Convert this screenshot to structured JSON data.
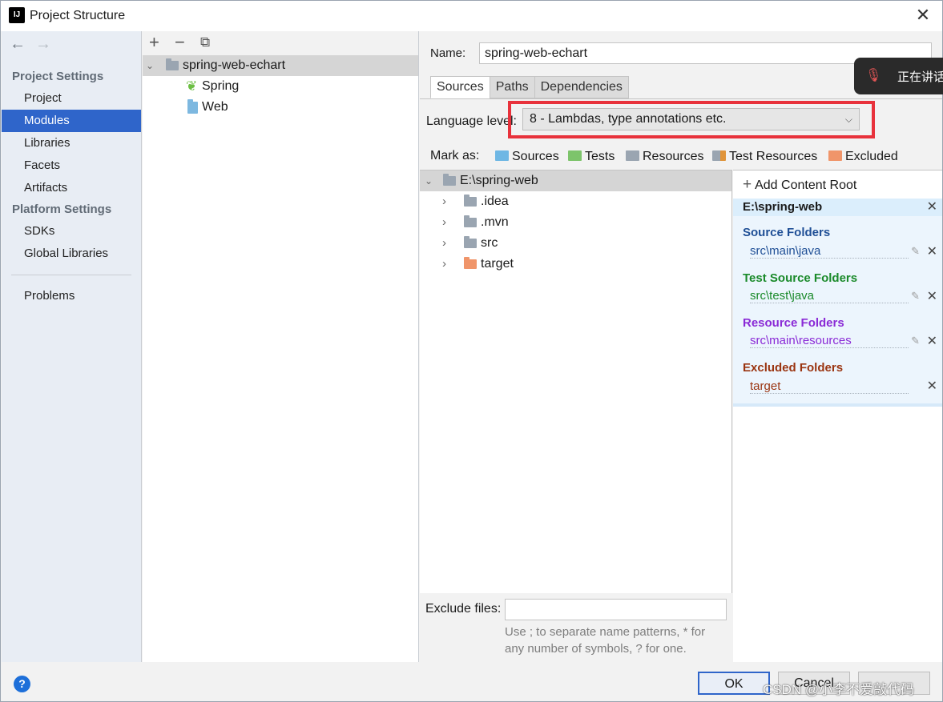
{
  "window": {
    "title": "Project Structure"
  },
  "nav": {
    "sections": [
      {
        "title": "Project Settings",
        "items": [
          "Project",
          "Modules",
          "Libraries",
          "Facets",
          "Artifacts"
        ]
      },
      {
        "title": "Platform Settings",
        "items": [
          "SDKs",
          "Global Libraries"
        ]
      }
    ],
    "problems": "Problems",
    "selected": "Modules"
  },
  "module_tree": {
    "root": "spring-web-echart",
    "children": [
      "Spring",
      "Web"
    ]
  },
  "module": {
    "name_label": "Name:",
    "name_value": "spring-web-echart",
    "tabs": [
      "Sources",
      "Paths",
      "Dependencies"
    ],
    "active_tab": "Sources",
    "language_level_label": "Language level:",
    "language_level_value": "8 - Lambdas, type annotations etc.",
    "mark_as_label": "Mark as:",
    "mark_as": [
      {
        "label": "Sources",
        "color": "#6fb7e4"
      },
      {
        "label": "Tests",
        "color": "#7dc46b"
      },
      {
        "label": "Resources",
        "color": "#9aa5b1"
      },
      {
        "label": "Test Resources",
        "color": "#9aa5b1"
      },
      {
        "label": "Excluded",
        "color": "#f0956a"
      }
    ],
    "content_tree": {
      "root": "E:\\spring-web",
      "children": [
        ".idea",
        ".mvn",
        "src",
        "target"
      ]
    },
    "exclude_files_label": "Exclude files:",
    "exclude_files_value": "",
    "exclude_hint_line1": "Use ; to separate name patterns, * for",
    "exclude_hint_line2": "any number of symbols, ? for one."
  },
  "content_roots": {
    "add_label": "Add Content Root",
    "root_path": "E:\\spring-web",
    "groups": [
      {
        "title": "Source Folders",
        "path": "src\\main\\java",
        "color": "#1f4f96"
      },
      {
        "title": "Test Source Folders",
        "path": "src\\test\\java",
        "color": "#1a8a2a"
      },
      {
        "title": "Resource Folders",
        "path": "src\\main\\resources",
        "color": "#8a2ad6"
      },
      {
        "title": "Excluded Folders",
        "path": "target",
        "color": "#9a3410"
      }
    ]
  },
  "buttons": {
    "ok": "OK",
    "cancel": "Cancel"
  },
  "toast": {
    "text": "正在讲话"
  },
  "watermark": "CSDN @小李不爱敲代码"
}
